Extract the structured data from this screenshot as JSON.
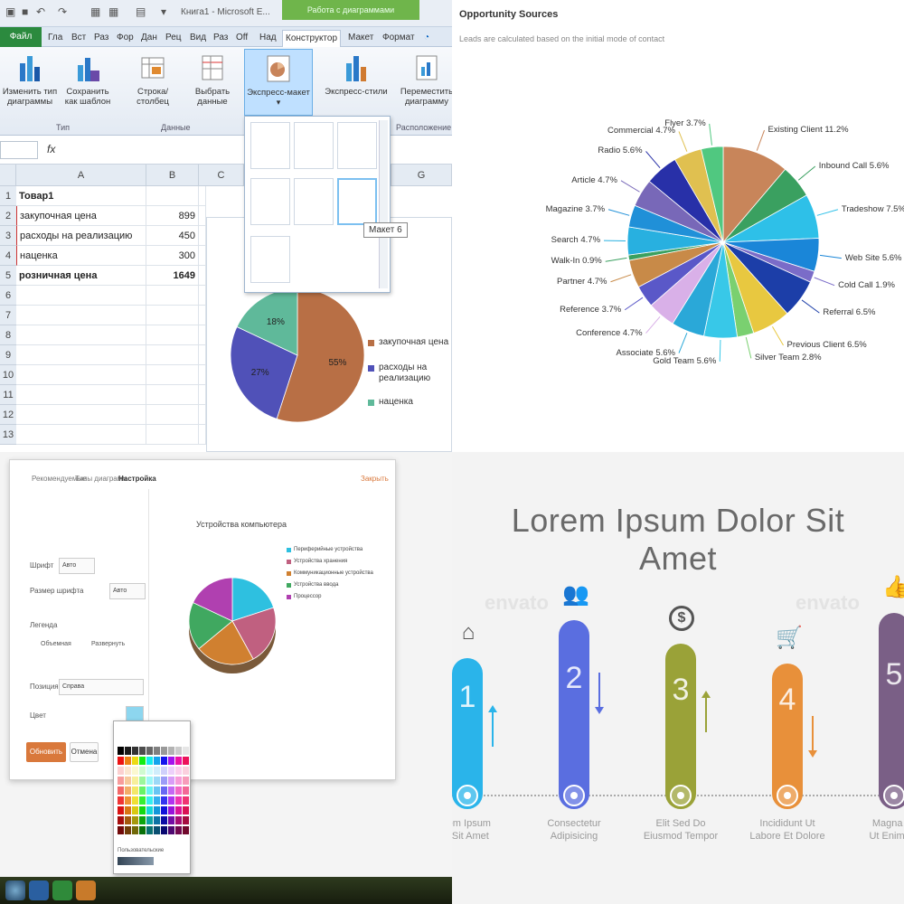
{
  "excel": {
    "window_title": "Книга1 - Microsoft E...",
    "context_tab": "Работа с диаграммами",
    "tabs": [
      "Файл",
      "Гла",
      "Вст",
      "Раз",
      "Фор",
      "Дан",
      "Рец",
      "Вид",
      "Раз",
      "Off",
      "Над",
      "Конструктор",
      "Макет",
      "Формат"
    ],
    "ribbon_buttons": [
      {
        "label": "Изменить тип диаграммы"
      },
      {
        "label": "Сохранить как шаблон"
      },
      {
        "label": "Строка/столбец"
      },
      {
        "label": "Выбрать данные"
      },
      {
        "label": "Экспресс-макет"
      },
      {
        "label": "Экспресс-стили"
      },
      {
        "label": "Переместить диаграмму"
      }
    ],
    "groups": [
      "Тип",
      "Данные",
      "Расположение"
    ],
    "formula_fx": "fx",
    "columns": [
      "A",
      "B",
      "C",
      "G"
    ],
    "rows": [
      "1",
      "2",
      "3",
      "4",
      "5",
      "6",
      "7",
      "8",
      "9",
      "10",
      "11",
      "12",
      "13"
    ],
    "table": [
      {
        "a": "Товар1",
        "b": ""
      },
      {
        "a": "закупочная цена",
        "b": "899"
      },
      {
        "a": "расходы на реализацию",
        "b": "450"
      },
      {
        "a": "наценка",
        "b": "300"
      },
      {
        "a": "розничная цена",
        "b": "1649"
      }
    ],
    "tooltip": "Макет 6",
    "chart": {
      "slices": [
        {
          "name": "закупочная цена",
          "pct": "55%",
          "value": 55,
          "color": "#b86f45"
        },
        {
          "name": "расходы на реализацию",
          "pct": "27%",
          "value": 27,
          "color": "#5051b8"
        },
        {
          "name": "наценка",
          "pct": "18%",
          "value": 18,
          "color": "#5fb99a"
        }
      ]
    }
  },
  "opportunity": {
    "title": "Opportunity Sources",
    "subtitle": "Leads are calculated based on the initial mode of contact",
    "slices": [
      {
        "label": "Existing Client",
        "pct": "11.2%",
        "value": 11.2,
        "color": "#c8855a"
      },
      {
        "label": "Inbound Call",
        "pct": "5.6%",
        "value": 5.6,
        "color": "#3aa060"
      },
      {
        "label": "Tradeshow",
        "pct": "7.5%",
        "value": 7.5,
        "color": "#2ec0e8"
      },
      {
        "label": "Web Site",
        "pct": "5.6%",
        "value": 5.6,
        "color": "#1a86d8"
      },
      {
        "label": "Cold Call",
        "pct": "1.9%",
        "value": 1.9,
        "color": "#7a6cc8"
      },
      {
        "label": "Referral",
        "pct": "6.5%",
        "value": 6.5,
        "color": "#1c3ea8"
      },
      {
        "label": "Previous Client",
        "pct": "6.5%",
        "value": 6.5,
        "color": "#e8c840"
      },
      {
        "label": "Silver Team",
        "pct": "2.8%",
        "value": 2.8,
        "color": "#7ad070"
      },
      {
        "label": "Gold Team",
        "pct": "5.6%",
        "value": 5.6,
        "color": "#38c8e8"
      },
      {
        "label": "Associate",
        "pct": "5.6%",
        "value": 5.6,
        "color": "#2aa8d8"
      },
      {
        "label": "Conference",
        "pct": "4.7%",
        "value": 4.7,
        "color": "#d9b0e8"
      },
      {
        "label": "Reference",
        "pct": "3.7%",
        "value": 3.7,
        "color": "#5a58c8"
      },
      {
        "label": "Partner",
        "pct": "4.7%",
        "value": 4.7,
        "color": "#c88a48"
      },
      {
        "label": "Walk-In",
        "pct": "0.9%",
        "value": 0.9,
        "color": "#3aa060"
      },
      {
        "label": "Search",
        "pct": "4.7%",
        "value": 4.7,
        "color": "#28b0e0"
      },
      {
        "label": "Magazine",
        "pct": "3.7%",
        "value": 3.7,
        "color": "#2090d8"
      },
      {
        "label": "Article",
        "pct": "4.7%",
        "value": 4.7,
        "color": "#7868b8"
      },
      {
        "label": "Radio",
        "pct": "5.6%",
        "value": 5.6,
        "color": "#2830a8"
      },
      {
        "label": "Commercial",
        "pct": "4.7%",
        "value": 4.7,
        "color": "#e0c050"
      },
      {
        "label": "Flyer",
        "pct": "3.7%",
        "value": 3.7,
        "color": "#50c880"
      }
    ]
  },
  "sheets_dialog": {
    "tabs": [
      "Рекомендуемые",
      "Типы диаграмм",
      "Настройка"
    ],
    "close_label": "Закрыть",
    "labels": {
      "title": "Шрифт",
      "text": "Размер шрифта",
      "legend": "Позиция",
      "color": "Цвет",
      "pos": "Легенда"
    },
    "fields": {
      "font": "Авто",
      "size": "Авто",
      "legend_pos": "Справа",
      "color": ""
    },
    "checkboxes": [
      "Объемная",
      "Развернуть"
    ],
    "chart_title": "Устройства компьютера",
    "legend": [
      {
        "label": "Периферийные устройства",
        "color": "#2ec0e0"
      },
      {
        "label": "Устройства хранения",
        "color": "#c06080"
      },
      {
        "label": "Коммуникационные устройства",
        "color": "#d08030"
      },
      {
        "label": "Устройства ввода",
        "color": "#40a860"
      },
      {
        "label": "Процессор",
        "color": "#b040b0"
      }
    ],
    "pie": [
      {
        "value": 20,
        "color": "#2ec0e0"
      },
      {
        "value": 22,
        "color": "#c06080"
      },
      {
        "value": 22,
        "color": "#d08030"
      },
      {
        "value": 18,
        "color": "#40a860"
      },
      {
        "value": 18,
        "color": "#b040b0"
      }
    ],
    "update_label": "Обновить",
    "cancel_label": "Отмена",
    "palette_custom": "Пользовательские"
  },
  "infographic": {
    "title": "Lorem Ipsum Dolor Sit Amet",
    "watermark": "envato",
    "steps": [
      {
        "num": "1",
        "caption": "rem Ipsum\nr Sit Amet",
        "color": "#2ab4ea",
        "icon": "home-icon",
        "direction": "up"
      },
      {
        "num": "2",
        "caption": "Consectetur\nAdipisicing",
        "color": "#5a6ee0",
        "icon": "people-icon",
        "direction": "down"
      },
      {
        "num": "3",
        "caption": "Elit Sed Do\nEiusmod Tempor",
        "color": "#9aa238",
        "icon": "dollar-icon",
        "direction": "up"
      },
      {
        "num": "4",
        "caption": "Incididunt Ut\nLabore Et Dolore",
        "color": "#e8903a",
        "icon": "cart-icon",
        "direction": "down"
      },
      {
        "num": "5",
        "caption": "Magna Ali\nUt Enim Ad",
        "color": "#7a5f86",
        "icon": "thumbs-up-icon",
        "direction": "up"
      }
    ]
  }
}
